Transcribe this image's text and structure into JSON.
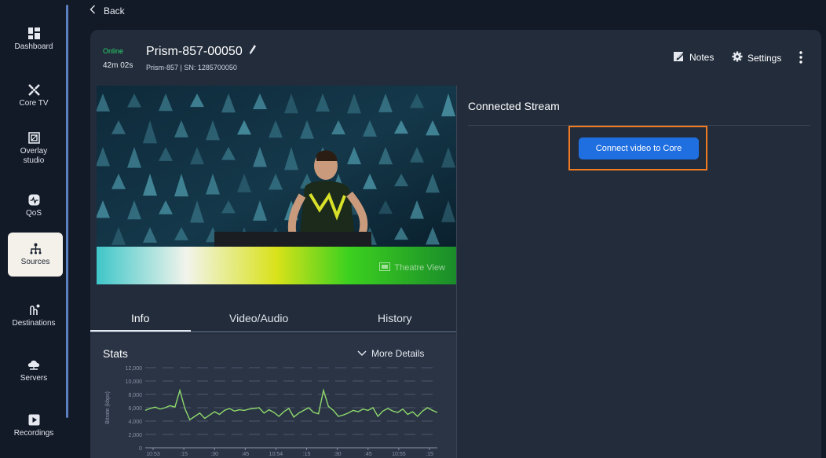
{
  "sidebar": {
    "items": [
      {
        "label": "Dashboard",
        "icon": "dashboard-icon"
      },
      {
        "label": "Core TV",
        "icon": "core-tv-icon"
      },
      {
        "label": "Overlay studio",
        "icon": "overlay-studio-icon"
      },
      {
        "label": "QoS",
        "icon": "qos-icon"
      },
      {
        "label": "Sources",
        "icon": "sources-icon",
        "active": true
      },
      {
        "label": "Destinations",
        "icon": "destinations-icon"
      },
      {
        "label": "Servers",
        "icon": "servers-icon"
      },
      {
        "label": "Recordings",
        "icon": "recordings-icon"
      }
    ]
  },
  "nav": {
    "back_label": "Back"
  },
  "device": {
    "status": "Online",
    "uptime": "42m 02s",
    "name": "Prism-857-00050",
    "subtitle": "Prism-857 | SN: 1285700050"
  },
  "header_actions": {
    "notes_label": "Notes",
    "settings_label": "Settings"
  },
  "video": {
    "theatre_label": "Theatre View"
  },
  "connected_stream": {
    "title": "Connected Stream",
    "button_label": "Connect video to Core"
  },
  "tabs": [
    {
      "label": "Info",
      "active": true
    },
    {
      "label": "Video/Audio"
    },
    {
      "label": "History"
    }
  ],
  "stats": {
    "title": "Stats",
    "more_label": "More Details"
  },
  "colors": {
    "accent": "#1f6fe0",
    "online": "#2bd36b",
    "highlight": "#f07b22",
    "series": "#8fd96b"
  },
  "chart_data": {
    "type": "line",
    "ylabel": "Bitrate (kbps)",
    "yticks": [
      "12,000",
      "10,000",
      "8,000",
      "6,000",
      "4,000",
      "2,000",
      "0"
    ],
    "ylim": [
      0,
      12000
    ],
    "xticks": [
      "10:53",
      ":15",
      ":30",
      ":45",
      "10:54",
      ":15",
      ":30",
      ":45",
      "10:55",
      ":15"
    ],
    "grid": true,
    "series": [
      {
        "values": [
          5600,
          5900,
          6100,
          5800,
          6000,
          6300,
          6100,
          8600,
          5900,
          4200,
          4700,
          5200,
          4400,
          4900,
          5400,
          5000,
          5600,
          5900,
          5500,
          5700,
          5600,
          5800,
          5900,
          6000,
          5200,
          5700,
          5300,
          4700,
          5400,
          5900,
          4600,
          5200,
          5600,
          6000,
          5300,
          5100,
          8600,
          6200,
          5600,
          4700,
          4900,
          5200,
          5600,
          5400,
          5800,
          5600,
          6000,
          4700,
          5500,
          5900,
          5500,
          5300,
          5800,
          5000,
          5400,
          4700,
          5500,
          6000,
          5600,
          5300
        ]
      }
    ]
  }
}
